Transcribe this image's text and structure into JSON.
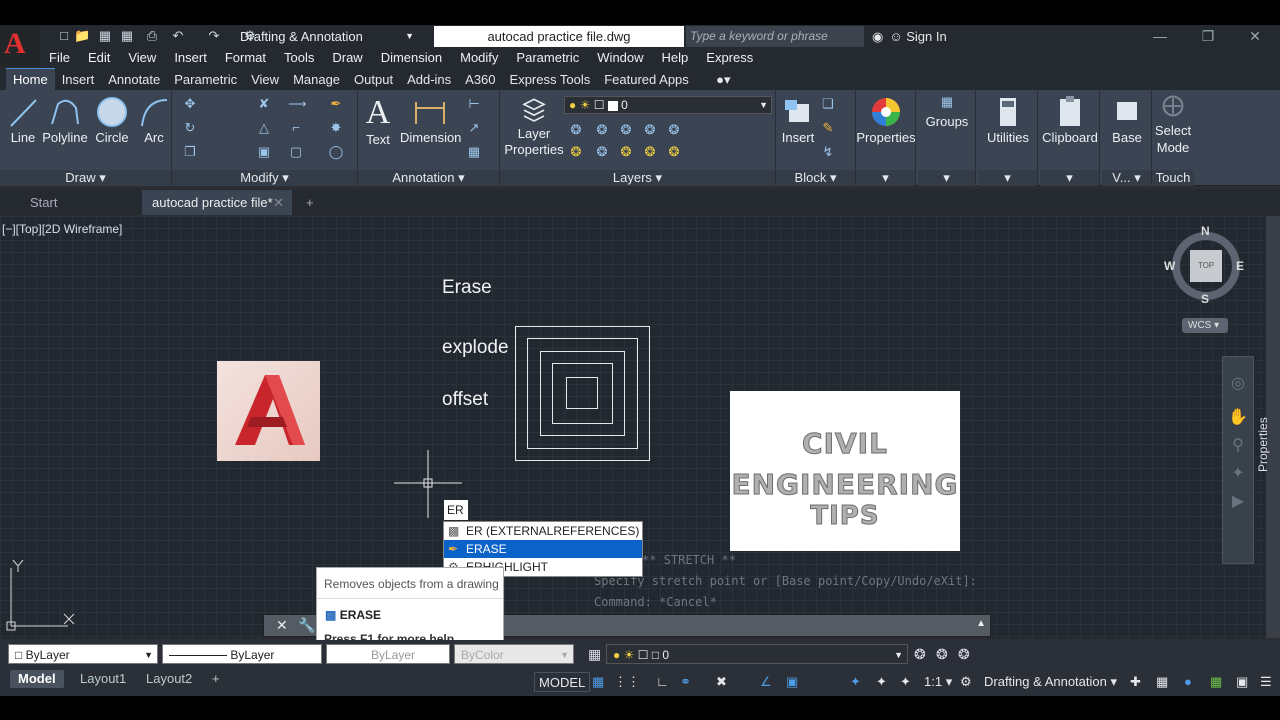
{
  "app": {
    "workspace": "Drafting & Annotation",
    "file_title": "autocad practice file.dwg",
    "search_placeholder": "Type a keyword or phrase",
    "sign_in": "Sign In"
  },
  "menu": [
    "File",
    "Edit",
    "View",
    "Insert",
    "Format",
    "Tools",
    "Draw",
    "Dimension",
    "Modify",
    "Parametric",
    "Window",
    "Help",
    "Express"
  ],
  "ribbon_tabs": [
    "Home",
    "Insert",
    "Annotate",
    "Parametric",
    "View",
    "Manage",
    "Output",
    "Add-ins",
    "A360",
    "Express Tools",
    "Featured Apps"
  ],
  "ribbon": {
    "draw": {
      "title": "Draw",
      "tools": [
        "Line",
        "Polyline",
        "Circle",
        "Arc"
      ]
    },
    "modify": {
      "title": "Modify"
    },
    "annotation": {
      "title": "Annotation",
      "tools": [
        "Text",
        "Dimension"
      ]
    },
    "layers": {
      "title": "Layers",
      "tool": "Layer",
      "tool2": "Properties",
      "current_layer": "0"
    },
    "block": {
      "title": "Block",
      "tool": "Insert"
    },
    "properties": "Properties",
    "groups": "Groups",
    "utilities": "Utilities",
    "clipboard": "Clipboard",
    "base": "Base",
    "v_title": "V...",
    "select_mode": {
      "line1": "Select",
      "line2": "Mode",
      "title": "Touch"
    }
  },
  "doc_tabs": {
    "start": "Start",
    "active": "autocad practice file*"
  },
  "viewport_label": "[−][Top][2D Wireframe]",
  "canvas_text": {
    "erase": "Erase",
    "explode": "explode",
    "offset": "offset"
  },
  "civil_box": {
    "line1": "CIVIL",
    "line2": "ENGINEERING",
    "line3": "TIPS"
  },
  "viewcube": {
    "n": "N",
    "s": "S",
    "e": "E",
    "w": "W",
    "top": "TOP",
    "wcs": "WCS"
  },
  "side_panel": "Properties",
  "command": {
    "input": "ER",
    "suggestions": [
      "ER (EXTERNALREFERENCES)",
      "ERASE",
      "ERHIGHLIGHT"
    ],
    "selected_index": 1,
    "history": [
      "** STRETCH **",
      "Specify stretch point or [Base point/Copy/Undo/eXit]:",
      "Command: *Cancel*"
    ]
  },
  "tooltip": {
    "desc": "Removes objects from a drawing",
    "name": "ERASE",
    "help": "Press F1 for more help"
  },
  "properties_bar": {
    "color": "ByLayer",
    "linetype": "ByLayer",
    "lineweight": "ByLayer",
    "plotstyle": "ByColor",
    "layer": "0"
  },
  "layout_tabs": [
    "Model",
    "Layout1",
    "Layout2"
  ],
  "status": {
    "model": "MODEL",
    "scale": "1:1",
    "workspace": "Drafting & Annotation"
  },
  "colors": {
    "accent": "#0b63c9",
    "autocad_red": "#e0302f",
    "canvas": "#212830"
  }
}
